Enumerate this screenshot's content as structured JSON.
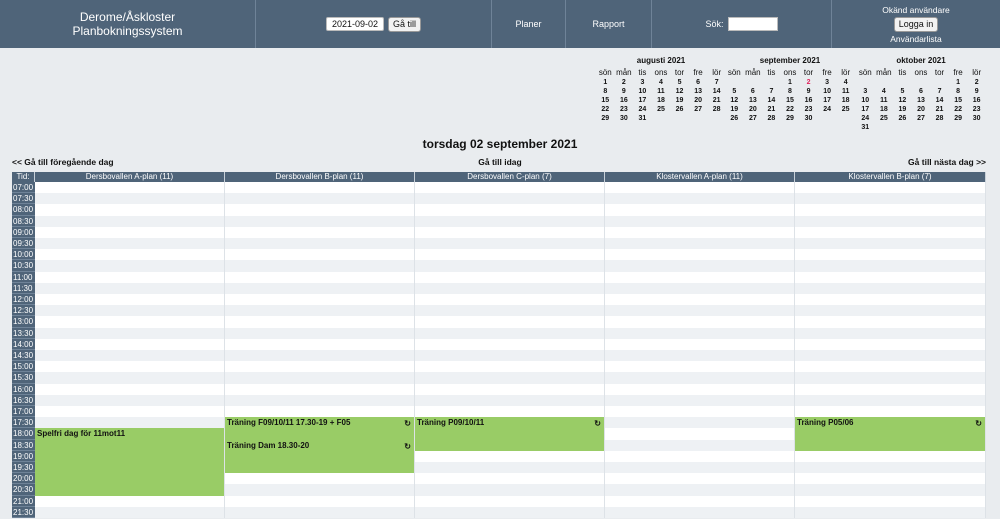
{
  "header": {
    "title_line1": "Derome/Åskloster",
    "title_line2": "Planbokningssystem",
    "date_value": "2021-09-02",
    "goto_label": "Gå till",
    "plans_label": "Planer",
    "report_label": "Rapport",
    "search_label": "Sök:",
    "user_status": "Okänd användare",
    "login_label": "Logga in",
    "userlist_label": "Användarlista"
  },
  "calendars": [
    {
      "title": "augusti 2021",
      "weekdays": [
        "sön",
        "mån",
        "tis",
        "ons",
        "tor",
        "fre",
        "lör"
      ],
      "weeks": [
        [
          "1",
          "2",
          "3",
          "4",
          "5",
          "6",
          "7"
        ],
        [
          "8",
          "9",
          "10",
          "11",
          "12",
          "13",
          "14"
        ],
        [
          "15",
          "16",
          "17",
          "18",
          "19",
          "20",
          "21"
        ],
        [
          "22",
          "23",
          "24",
          "25",
          "26",
          "27",
          "28"
        ],
        [
          "29",
          "30",
          "31",
          "",
          "",
          "",
          ""
        ]
      ],
      "today": ""
    },
    {
      "title": "september 2021",
      "weekdays": [
        "sön",
        "mån",
        "tis",
        "ons",
        "tor",
        "fre",
        "lör"
      ],
      "weeks": [
        [
          "",
          "",
          "",
          "1",
          "2",
          "3",
          "4"
        ],
        [
          "5",
          "6",
          "7",
          "8",
          "9",
          "10",
          "11"
        ],
        [
          "12",
          "13",
          "14",
          "15",
          "16",
          "17",
          "18"
        ],
        [
          "19",
          "20",
          "21",
          "22",
          "23",
          "24",
          "25"
        ],
        [
          "26",
          "27",
          "28",
          "29",
          "30",
          "",
          ""
        ]
      ],
      "today": "2"
    },
    {
      "title": "oktober 2021",
      "weekdays": [
        "sön",
        "mån",
        "tis",
        "ons",
        "tor",
        "fre",
        "lör"
      ],
      "weeks": [
        [
          "",
          "",
          "",
          "",
          "",
          "1",
          "2"
        ],
        [
          "3",
          "4",
          "5",
          "6",
          "7",
          "8",
          "9"
        ],
        [
          "10",
          "11",
          "12",
          "13",
          "14",
          "15",
          "16"
        ],
        [
          "17",
          "18",
          "19",
          "20",
          "21",
          "22",
          "23"
        ],
        [
          "24",
          "25",
          "26",
          "27",
          "28",
          "29",
          "30"
        ],
        [
          "31",
          "",
          "",
          "",
          "",
          "",
          ""
        ]
      ],
      "today": ""
    }
  ],
  "day_title": "torsdag 02 september 2021",
  "nav": {
    "prev": "<< Gå till föregående dag",
    "today": "Gå till idag",
    "next": "Gå till nästa dag >>"
  },
  "schedule": {
    "time_header": "Tid:",
    "columns": [
      "Dersbovallen A-plan (11)",
      "Dersbovallen B-plan (11)",
      "Dersbovallen C-plan (7)",
      "Klostervallen A-plan (11)",
      "Klostervallen B-plan (7)"
    ],
    "times": [
      "07:00",
      "07:30",
      "08:00",
      "08:30",
      "09:00",
      "09:30",
      "10:00",
      "10:30",
      "11:00",
      "11:30",
      "12:00",
      "12:30",
      "13:00",
      "13:30",
      "14:00",
      "14:30",
      "15:00",
      "15:30",
      "16:00",
      "16:30",
      "17:00",
      "17:30",
      "18:00",
      "18:30",
      "19:00",
      "19:30",
      "20:00",
      "20:30",
      "21:00",
      "21:30"
    ],
    "events": [
      {
        "title": "Spelfri dag för 11mot11",
        "column": 0,
        "start": "18:00",
        "end": "21:00",
        "icon": ""
      },
      {
        "title": "Träning F09/10/11 17.30-19 + F05",
        "column": 1,
        "start": "17:30",
        "end": "18:30",
        "icon": "refresh-icon"
      },
      {
        "title": "Träning Dam 18.30-20",
        "column": 1,
        "start": "18:30",
        "end": "20:00",
        "icon": "refresh-icon"
      },
      {
        "title": "Träning P09/10/11",
        "column": 2,
        "start": "17:30",
        "end": "19:00",
        "icon": "refresh-icon"
      },
      {
        "title": "Träning P05/06",
        "column": 4,
        "start": "17:30",
        "end": "19:00",
        "icon": "refresh-icon"
      }
    ]
  }
}
